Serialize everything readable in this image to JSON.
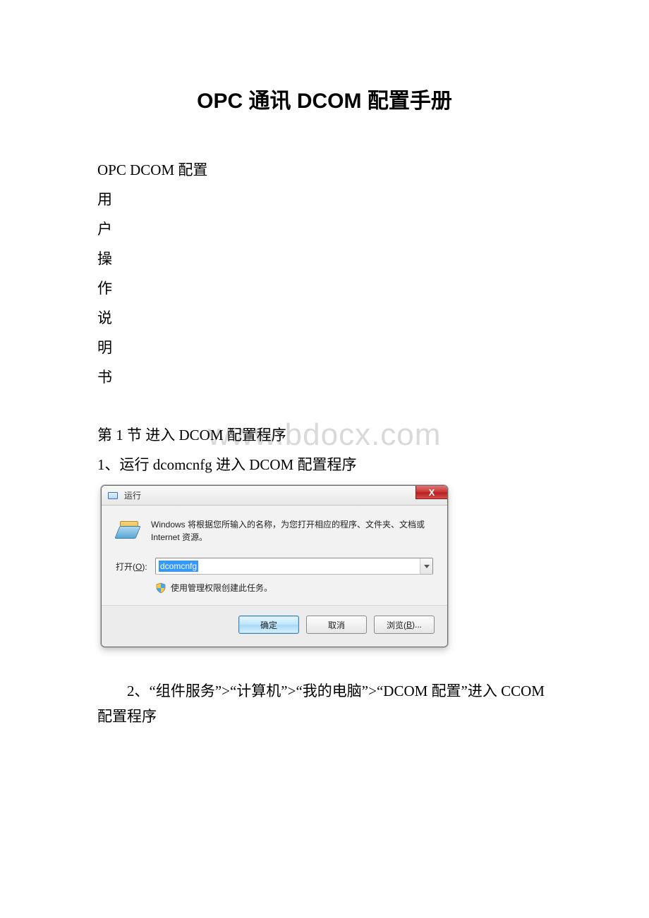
{
  "title": "OPC 通讯 DCOM 配置手册",
  "subtitle_lines": [
    "OPC DCOM 配置",
    "用",
    "户",
    "操",
    "作",
    "说",
    "明",
    "书"
  ],
  "section1": "第 1 节  进入 DCOM 配置程序",
  "step1": "1、运行 dcomcnfg 进入 DCOM 配置程序",
  "watermark": "www.bdocx.com",
  "run_dialog": {
    "title": "运行",
    "close_glyph": "X",
    "description": "Windows 将根据您所输入的名称，为您打开相应的程序、文件夹、文档或 Internet 资源。",
    "open_label_prefix": "打开(",
    "open_label_key": "O",
    "open_label_suffix": "):",
    "input_value": "dcomcnfg",
    "admin_text": "使用管理权限创建此任务。",
    "buttons": {
      "ok": "确定",
      "cancel": "取消",
      "browse_prefix": "浏览(",
      "browse_key": "B",
      "browse_suffix": ")..."
    }
  },
  "step2_pre": "　　2、“组件服务”>“计算机”>“我的电脑”>“DCOM 配置”进入 CCOM",
  "step2_line2": "配置程序"
}
